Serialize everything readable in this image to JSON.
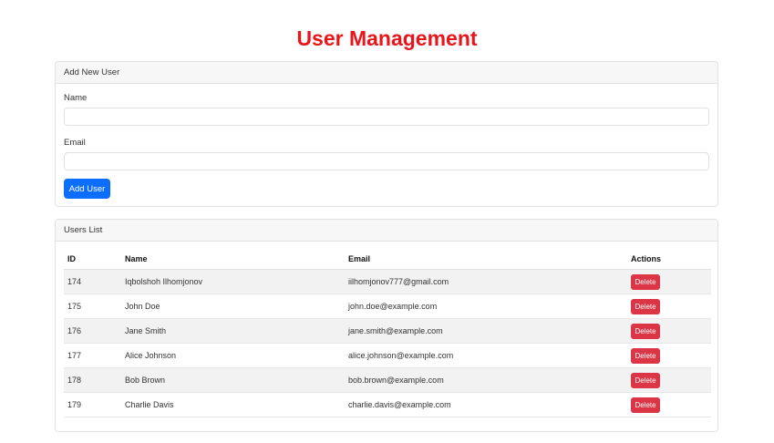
{
  "page": {
    "title": "User Management"
  },
  "add_form": {
    "header": "Add New User",
    "name_label": "Name",
    "name_value": "",
    "email_label": "Email",
    "email_value": "",
    "submit_label": "Add User"
  },
  "users_list": {
    "header": "Users List",
    "columns": {
      "id": "ID",
      "name": "Name",
      "email": "Email",
      "actions": "Actions"
    },
    "delete_label": "Delete",
    "rows": [
      {
        "id": "174",
        "name": "Iqbolshoh Ilhomjonov",
        "email": "iilhomjonov777@gmail.com"
      },
      {
        "id": "175",
        "name": "John Doe",
        "email": "john.doe@example.com"
      },
      {
        "id": "176",
        "name": "Jane Smith",
        "email": "jane.smith@example.com"
      },
      {
        "id": "177",
        "name": "Alice Johnson",
        "email": "alice.johnson@example.com"
      },
      {
        "id": "178",
        "name": "Bob Brown",
        "email": "bob.brown@example.com"
      },
      {
        "id": "179",
        "name": "Charlie Davis",
        "email": "charlie.davis@example.com"
      }
    ]
  },
  "colors": {
    "title": "#e8161b",
    "primary": "#0d6efd",
    "danger": "#dc3545",
    "stripe": "#f2f2f2"
  }
}
